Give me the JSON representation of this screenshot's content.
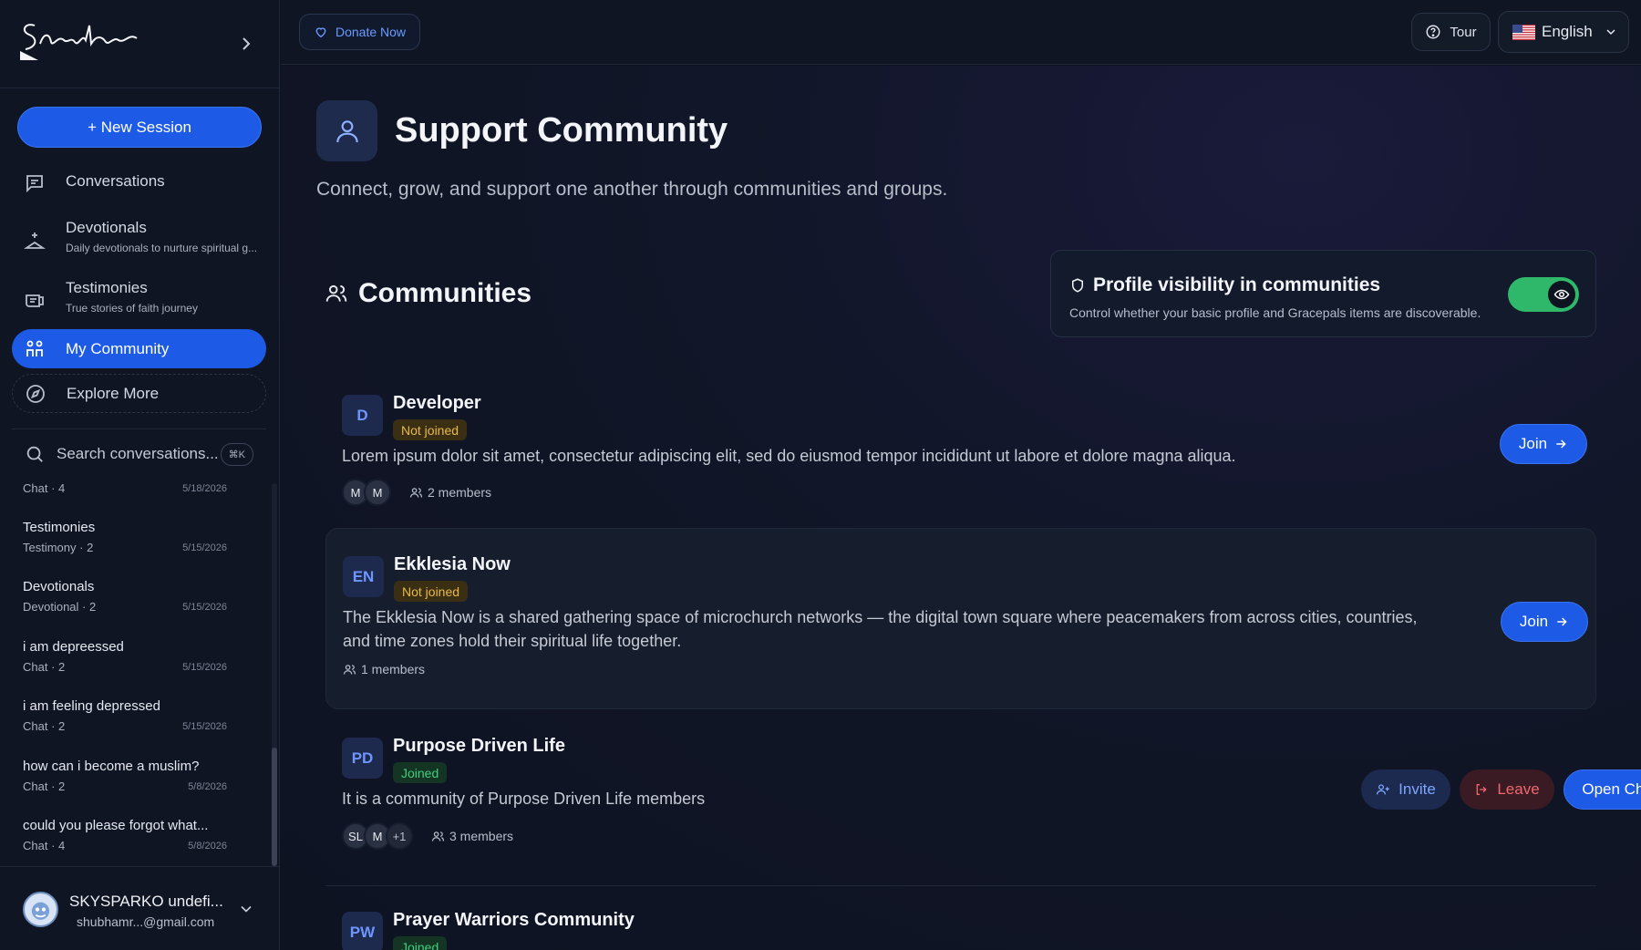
{
  "sidebar": {
    "new_session": "+ New Session",
    "nav": [
      {
        "label": "Conversations",
        "sub": "",
        "icon": "message-icon"
      },
      {
        "label": "Devotionals",
        "sub": "Daily devotionals to nurture spiritual g...",
        "icon": "bible-icon"
      },
      {
        "label": "Testimonies",
        "sub": "True stories of faith journey",
        "icon": "scroll-icon"
      },
      {
        "label": "My Community",
        "sub": "",
        "icon": "community-icon"
      },
      {
        "label": "Explore More",
        "sub": "",
        "icon": "compass-icon"
      }
    ],
    "search_placeholder": "Search conversations...",
    "search_shortcut": "⌘K",
    "conversations": [
      {
        "title": "",
        "meta": "Chat · 4",
        "date": "5/18/2026"
      },
      {
        "title": "Testimonies",
        "meta": "Testimony · 2",
        "date": "5/15/2026"
      },
      {
        "title": "Devotionals",
        "meta": "Devotional · 2",
        "date": "5/15/2026"
      },
      {
        "title": "i am depreessed",
        "meta": "Chat · 2",
        "date": "5/15/2026"
      },
      {
        "title": "i am feeling depressed",
        "meta": "Chat · 2",
        "date": "5/15/2026"
      },
      {
        "title": "how can i become a muslim?",
        "meta": "Chat · 2",
        "date": "5/8/2026"
      },
      {
        "title": "could you please forgot what...",
        "meta": "Chat · 4",
        "date": "5/8/2026"
      }
    ],
    "user": {
      "name": "SKYSPARKO undefi...",
      "email": "shubhamr...@gmail.com"
    }
  },
  "topbar": {
    "donate": "Donate Now",
    "tour": "Tour",
    "language": "English"
  },
  "main": {
    "title": "Support Community",
    "subtitle": "Connect, grow, and support one another through communities and groups.",
    "communities_heading": "Communities",
    "visibility": {
      "title": "Profile visibility in communities",
      "desc": "Control whether your basic profile and Gracepals items are discoverable.",
      "enabled": true
    },
    "communities": [
      {
        "initials": "D",
        "name": "Developer",
        "status": "Not joined",
        "desc": "Lorem ipsum dolor sit amet, consectetur adipiscing elit, sed do eiusmod tempor incididunt ut labore et dolore magna aliqua.",
        "desc2": "",
        "members": [
          "M",
          "M"
        ],
        "member_count": "2 members",
        "action": "Join"
      },
      {
        "initials": "EN",
        "name": "Ekklesia Now",
        "status": "Not joined",
        "desc": "The Ekklesia Now is a shared gathering space of microchurch networks — the digital town square where peacemakers from across cities, countries,",
        "desc2": "and time zones hold their spiritual life together.",
        "members": [],
        "member_count": "1 members",
        "action": "Join"
      },
      {
        "initials": "PD",
        "name": "Purpose Driven Life",
        "status": "Joined",
        "desc": "It is a community of Purpose Driven Life members",
        "desc2": "",
        "members": [
          "SL",
          "M",
          "+1"
        ],
        "member_count": "3 members",
        "invite": "Invite",
        "leave": "Leave",
        "open_chat": "Open Chat"
      },
      {
        "initials": "PW",
        "name": "Prayer Warriors Community",
        "status": "Joined"
      }
    ]
  },
  "colors": {
    "accent": "#1d5be6",
    "joined": "#3fd07f",
    "not_joined": "#e8b84a",
    "leave": "#f0686e",
    "toggle_on": "#2fb86a"
  }
}
